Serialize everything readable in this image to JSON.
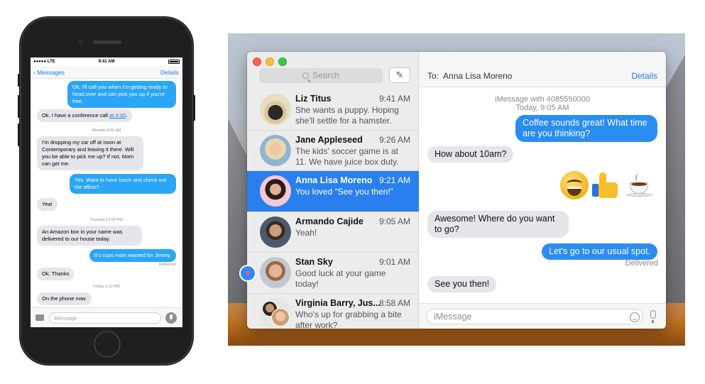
{
  "phone": {
    "status": {
      "carrier": "●●●●● LTE",
      "time": "9:41 AM"
    },
    "nav": {
      "back": "Messages",
      "details": "Details"
    },
    "messages": [
      {
        "text": "Ok, I'll call you when I'm getting ready to head over and can pick you up if you're free."
      },
      {
        "text": "Ok. I have a conference call ",
        "link": "at 4:30",
        "end": "."
      },
      {
        "timestamp": "Monday 8:00 AM"
      },
      {
        "text": "I'm dropping my car off at noon at Contemporary and leaving it there. Will you be able to pick me up? If not, Mom can get me."
      },
      {
        "text": "Yes. Want to have lunch and check out the office?"
      },
      {
        "text": "Yea!"
      },
      {
        "timestamp": "Tuesday 12:50 PM"
      },
      {
        "text": "An Amazon box in your name was delivered to our house today."
      },
      {
        "text": "It's cups mom wanted for Jimmy."
      },
      {
        "status": "Delivered"
      },
      {
        "text": "Ok. Thanks"
      },
      {
        "timestamp": "Friday 1:22 PM"
      },
      {
        "text": "On the phone now."
      }
    ],
    "input_placeholder": "iMessage"
  },
  "mac": {
    "search_placeholder": "Search",
    "compose_icon": "compose-icon",
    "conversations": [
      {
        "name": "Liz Titus",
        "time": "9:41 AM",
        "preview": "She wants a puppy. Hoping she'll settle for a hamster."
      },
      {
        "name": "Jane Appleseed",
        "time": "9:26 AM",
        "preview": "The kids' soccer game is at 11. We have juice box duty."
      },
      {
        "name": "Anna Lisa Moreno",
        "time": "9:21 AM",
        "preview": "You loved “See you then!”",
        "selected": true
      },
      {
        "name": "Armando Cajide",
        "time": "9:05 AM",
        "preview": "Yeah!"
      },
      {
        "name": "Stan Sky",
        "time": "9:01 AM",
        "preview": "Good luck at your game today!"
      },
      {
        "name": "Virginia Barry, Jus...",
        "time": "8:58 AM",
        "preview": "Who's up for grabbing a bite after work?"
      }
    ],
    "header": {
      "to_label": "To:",
      "recipient": "Anna Lisa Moreno",
      "details": "Details"
    },
    "meta": {
      "line1": "iMessage with 4085550000",
      "line2": "Today, 9:05 AM"
    },
    "messages": [
      {
        "text": "Coffee sounds great! What time are you thinking?"
      },
      {
        "text": "How about 10am?"
      },
      {
        "text": "Awesome! Where do you want to go?"
      },
      {
        "text": "Let's go to our usual spot."
      },
      {
        "status": "Delivered"
      },
      {
        "text": "See you then!"
      }
    ],
    "emojis": [
      "grinning-face-emoji",
      "thumbs-up-emoji",
      "hot-beverage-emoji"
    ],
    "tapback": "heart",
    "input_placeholder": "iMessage",
    "colors": {
      "accent": "#2a7fee",
      "bubble_out": "#2a8df2",
      "bubble_in": "#e5e5ea"
    }
  }
}
